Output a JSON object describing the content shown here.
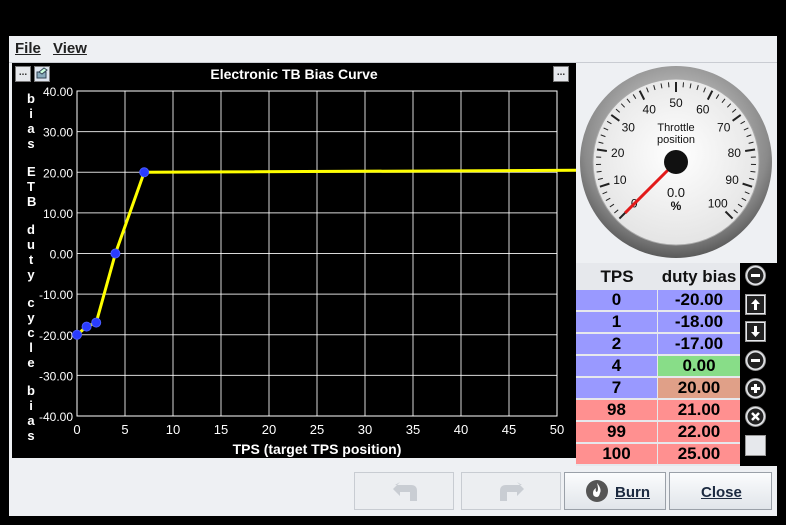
{
  "menu": {
    "file": "File",
    "view": "View"
  },
  "chart_panel": {
    "title": "Electronic TB Bias Curve",
    "left_button": "...",
    "right_button": "..."
  },
  "chart_data": {
    "type": "line",
    "title": "Electronic TB Bias Curve",
    "xlabel": "TPS (target TPS position)",
    "ylabel": "bias ETB duty cycle bias",
    "xlim": [
      0,
      50
    ],
    "ylim": [
      -40,
      40
    ],
    "x_ticks": [
      "0",
      "5",
      "10",
      "15",
      "20",
      "25",
      "30",
      "35",
      "40",
      "45",
      "50"
    ],
    "y_ticks": [
      "40.00",
      "30.00",
      "20.00",
      "10.00",
      "0.00",
      "-10.00",
      "-20.00",
      "-30.00",
      "-40.00"
    ],
    "grid": true,
    "series": [
      {
        "color": "#ffff00",
        "x": [
          0,
          1,
          2,
          4,
          7,
          98,
          99,
          100
        ],
        "y": [
          -20,
          -18,
          -17,
          0,
          20,
          21,
          22,
          25
        ]
      }
    ]
  },
  "gauge": {
    "title_line1": "Throttle",
    "title_line2": "position",
    "value": "0.0",
    "unit": "%",
    "min": 0,
    "max": 100,
    "ticks": [
      "0",
      "10",
      "20",
      "30",
      "40",
      "50",
      "60",
      "70",
      "80",
      "90",
      "100"
    ],
    "needle_value": 0
  },
  "table": {
    "col1": "TPS",
    "col2": "duty bias",
    "rows": [
      {
        "tps": "0",
        "bias": "-20.00",
        "tps_color": "#9999ff",
        "bias_color": "#9999ff"
      },
      {
        "tps": "1",
        "bias": "-18.00",
        "tps_color": "#9999ff",
        "bias_color": "#9999ff"
      },
      {
        "tps": "2",
        "bias": "-17.00",
        "tps_color": "#9999ff",
        "bias_color": "#9999ff"
      },
      {
        "tps": "4",
        "bias": "0.00",
        "tps_color": "#9999ff",
        "bias_color": "#88dd88"
      },
      {
        "tps": "7",
        "bias": "20.00",
        "tps_color": "#9999ff",
        "bias_color": "#e0a088"
      },
      {
        "tps": "98",
        "bias": "21.00",
        "tps_color": "#ff9090",
        "bias_color": "#ff9090"
      },
      {
        "tps": "99",
        "bias": "22.00",
        "tps_color": "#ff9090",
        "bias_color": "#ff9090"
      },
      {
        "tps": "100",
        "bias": "25.00",
        "tps_color": "#ff9090",
        "bias_color": "#ff9090"
      }
    ]
  },
  "buttons": {
    "burn": "Burn",
    "close": "Close"
  }
}
